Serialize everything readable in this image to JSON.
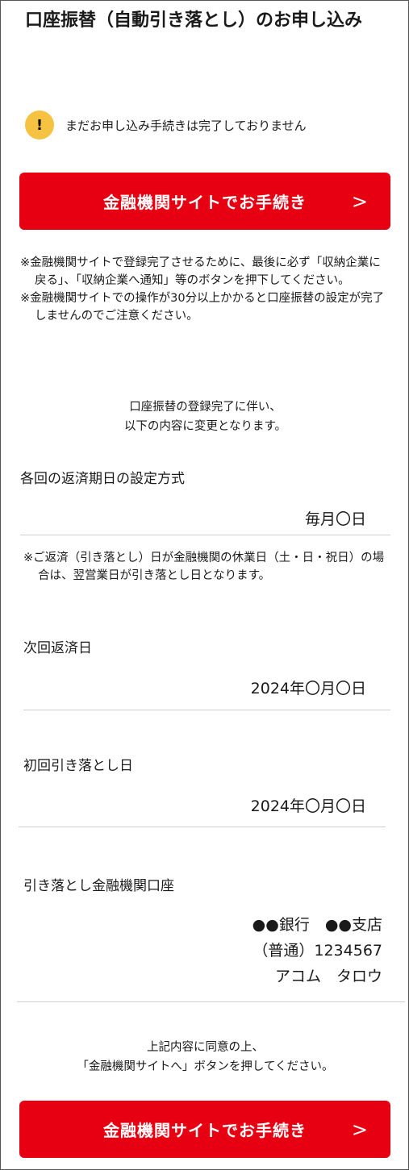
{
  "page": {
    "title": "口座振替（自動引き落とし）のお申し込み"
  },
  "notice": {
    "icon": "exclamation-icon",
    "text": "まだお申し込み手続きは完了しておりません"
  },
  "primary_button": {
    "label": "金融機関サイトでお手続き",
    "arrow": ">"
  },
  "notes": [
    "※金融機関サイトで登録完了させるために、最後に必ず「収納企業に戻る」、「収納企業へ通知」等のボタンを押下してください。",
    "※金融機関サイトでの操作が30分以上かかると口座振替の設定が完了しませんのでご注意ください。"
  ],
  "change_notice": {
    "line1": "口座振替の登録完了に伴い、",
    "line2": "以下の内容に変更となります。"
  },
  "fields": {
    "repayment_method": {
      "label": "各回の返済期日の設定方式",
      "value": "毎月〇日"
    },
    "repayment_note": "※ご返済（引き落とし）日が金融機関の休業日（土・日・祝日）の場合は、翌営業日が引き落とし日となります。",
    "next_repayment": {
      "label": "次回返済日",
      "value": "2024年〇月〇日"
    },
    "first_debit": {
      "label": "初回引き落とし日",
      "value": "2024年〇月〇日"
    },
    "account": {
      "label": "引き落とし金融機関口座",
      "line1": "●●銀行　●●支店",
      "line2": "（普通）1234567",
      "line3": "アコム　タロウ"
    }
  },
  "agreement": {
    "line1": "上記内容に同意の上、",
    "line2": "「金融機関サイトへ」ボタンを押してください。"
  },
  "colors": {
    "accent_red": "#e60012",
    "warning_yellow": "#f5c242",
    "divider": "#cfcfcf"
  }
}
